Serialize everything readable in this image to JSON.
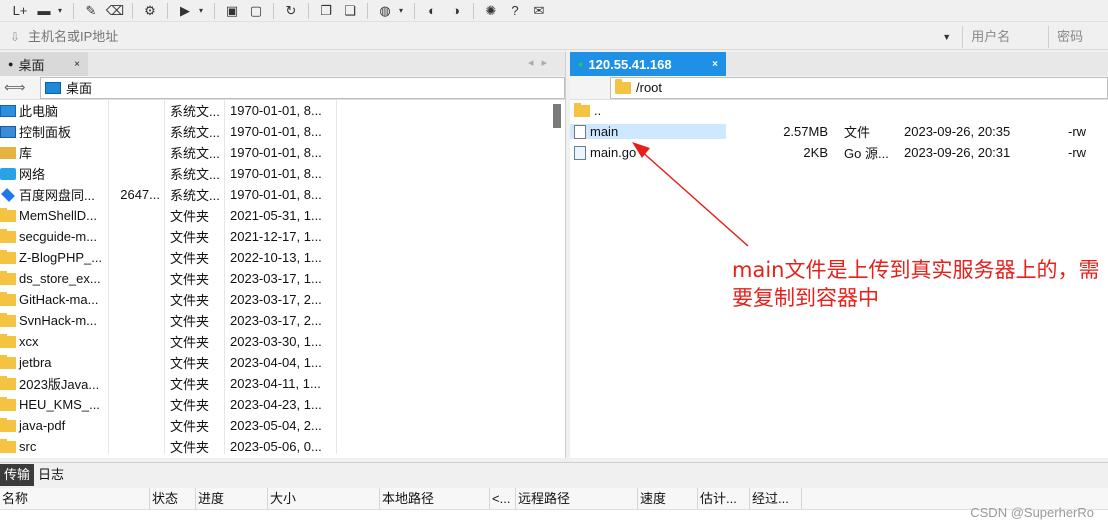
{
  "address_bar": {
    "placeholder": "主机名或IP地址",
    "user_placeholder": "用户名",
    "password_placeholder": "密码"
  },
  "left_panel": {
    "tab_label": "桌面",
    "path": "桌面",
    "files": [
      {
        "name": "此电脑",
        "size": "",
        "type": "系统文...",
        "date": "1970-01-01, 8...",
        "icon": "computer-icon"
      },
      {
        "name": "控制面板",
        "size": "",
        "type": "系统文...",
        "date": "1970-01-01, 8...",
        "icon": "control-panel-icon"
      },
      {
        "name": "库",
        "size": "",
        "type": "系统文...",
        "date": "1970-01-01, 8...",
        "icon": "library-icon"
      },
      {
        "name": "网络",
        "size": "",
        "type": "系统文...",
        "date": "1970-01-01, 8...",
        "icon": "network-icon"
      },
      {
        "name": "百度网盘同...",
        "size": "2647...",
        "type": "系统文...",
        "date": "1970-01-01, 8...",
        "icon": "baidu-netdisk-icon"
      },
      {
        "name": "MemShellD...",
        "size": "",
        "type": "文件夹",
        "date": "2021-05-31, 1...",
        "icon": "folder-icon"
      },
      {
        "name": "secguide-m...",
        "size": "",
        "type": "文件夹",
        "date": "2021-12-17, 1...",
        "icon": "folder-icon"
      },
      {
        "name": "Z-BlogPHP_...",
        "size": "",
        "type": "文件夹",
        "date": "2022-10-13, 1...",
        "icon": "folder-icon"
      },
      {
        "name": "ds_store_ex...",
        "size": "",
        "type": "文件夹",
        "date": "2023-03-17, 1...",
        "icon": "folder-icon"
      },
      {
        "name": "GitHack-ma...",
        "size": "",
        "type": "文件夹",
        "date": "2023-03-17, 2...",
        "icon": "folder-icon"
      },
      {
        "name": "SvnHack-m...",
        "size": "",
        "type": "文件夹",
        "date": "2023-03-17, 2...",
        "icon": "folder-icon"
      },
      {
        "name": "xcx",
        "size": "",
        "type": "文件夹",
        "date": "2023-03-30, 1...",
        "icon": "folder-icon"
      },
      {
        "name": "jetbra",
        "size": "",
        "type": "文件夹",
        "date": "2023-04-04, 1...",
        "icon": "folder-icon"
      },
      {
        "name": "2023版Java...",
        "size": "",
        "type": "文件夹",
        "date": "2023-04-11, 1...",
        "icon": "folder-icon"
      },
      {
        "name": "HEU_KMS_...",
        "size": "",
        "type": "文件夹",
        "date": "2023-04-23, 1...",
        "icon": "folder-icon"
      },
      {
        "name": "java-pdf",
        "size": "",
        "type": "文件夹",
        "date": "2023-05-04, 2...",
        "icon": "folder-icon"
      },
      {
        "name": "src",
        "size": "",
        "type": "文件夹",
        "date": "2023-05-06, 0...",
        "icon": "folder-icon"
      }
    ]
  },
  "right_panel": {
    "tab_label": "120.55.41.168",
    "path": "/root",
    "parent_dir": "..",
    "files": [
      {
        "name": "main",
        "size": "2.57MB",
        "type": "文件",
        "date": "2023-09-26, 20:35",
        "perm": "-rw",
        "selected": true,
        "icon": "file-icon"
      },
      {
        "name": "main.go",
        "size": "2KB",
        "type": "Go 源...",
        "date": "2023-09-26, 20:31",
        "perm": "-rw",
        "selected": false,
        "icon": "go-file-icon"
      }
    ]
  },
  "annotation": {
    "line1": "main文件是上传到真实服务器上的，需",
    "line2": "要复制到容器中",
    "color": "#e8201a"
  },
  "bottom_panel": {
    "tabs": [
      "传输",
      "日志"
    ],
    "columns": [
      "名称",
      "状态",
      "进度",
      "大小",
      "本地路径",
      "<...",
      "远程路径",
      "速度",
      "估计...",
      "经过..."
    ]
  },
  "watermark": "CSDN @SuperherRo"
}
